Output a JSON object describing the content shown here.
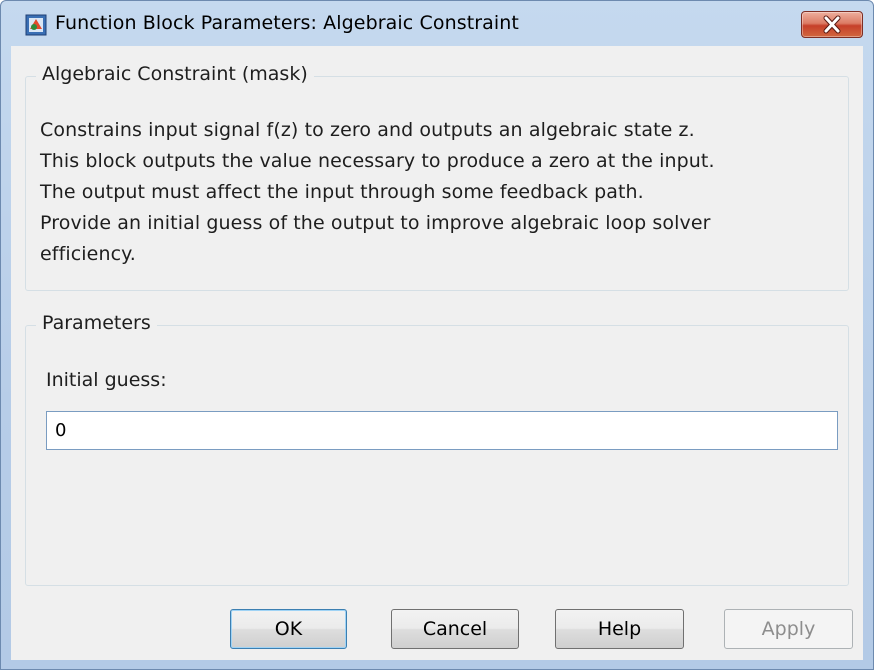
{
  "window": {
    "title": "Function Block Parameters: Algebraic Constraint",
    "icon": "simulink-block-icon",
    "close_icon": "close-icon"
  },
  "description_group": {
    "title": "Algebraic Constraint (mask)",
    "lines": [
      "Constrains input signal f(z) to zero and outputs an algebraic state z.",
      "This block outputs the value necessary to produce a zero at the input.",
      "The output must affect the input through some feedback path.",
      "Provide an initial guess of the output to improve algebraic loop solver",
      "efficiency."
    ]
  },
  "parameters_group": {
    "title": "Parameters",
    "initial_guess_label": "Initial guess:",
    "initial_guess_value": "0"
  },
  "buttons": {
    "ok": "OK",
    "cancel": "Cancel",
    "help": "Help",
    "apply": "Apply"
  },
  "colors": {
    "close_button": "#c6402a",
    "default_button_border": "#3c7fb1",
    "input_border": "#7a9cc1"
  }
}
